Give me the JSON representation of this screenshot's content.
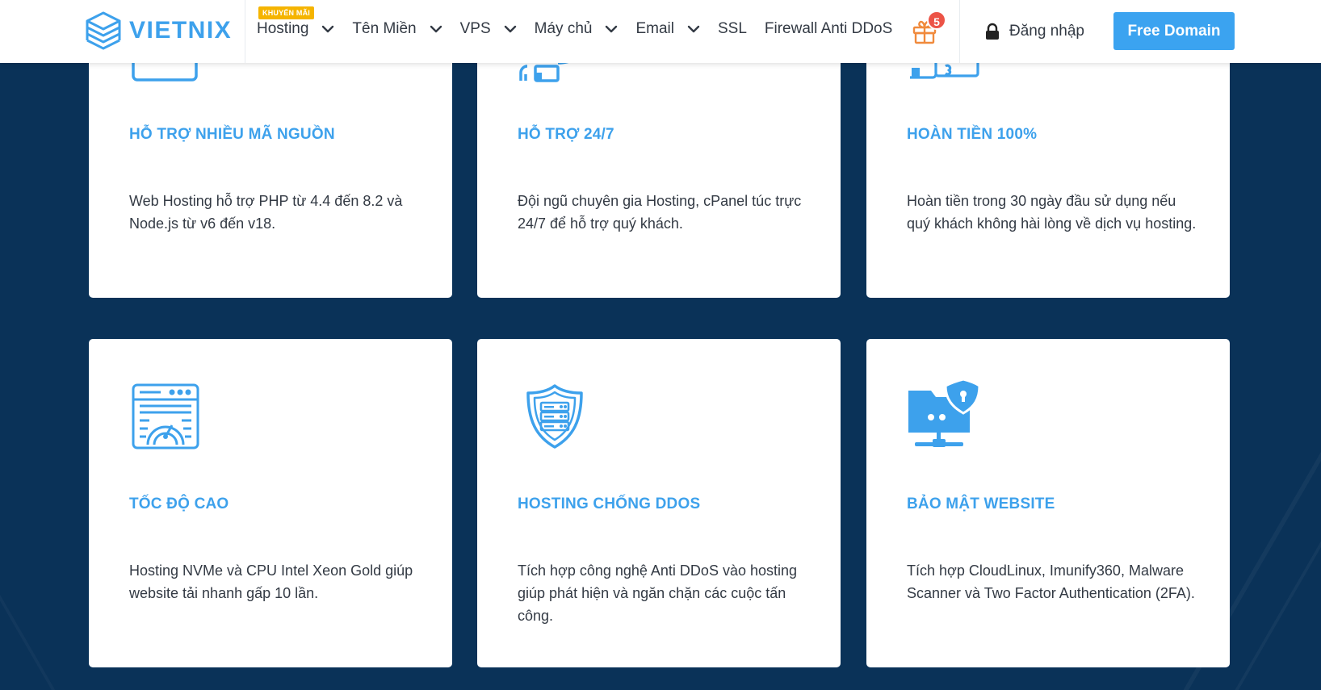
{
  "brand": {
    "name": "VIETNIX",
    "color": "#3da1ec"
  },
  "nav": {
    "promo_badge": "KHUYẾN MÃI",
    "items": [
      {
        "label": "Hosting",
        "dropdown": true
      },
      {
        "label": "Tên Miền",
        "dropdown": true
      },
      {
        "label": "VPS",
        "dropdown": true
      },
      {
        "label": "Máy chủ",
        "dropdown": true
      },
      {
        "label": "Email",
        "dropdown": true
      },
      {
        "label": "SSL",
        "dropdown": false
      },
      {
        "label": "Firewall Anti DDoS",
        "dropdown": false
      }
    ],
    "gift_count": "5",
    "login_label": "Đăng nhập",
    "cta_label": "Free Domain"
  },
  "colors": {
    "background": "#0a3258",
    "accent": "#3ba3f0",
    "badge": "#ec5346",
    "promo": "#f5b400"
  },
  "features": [
    {
      "icon": "code-window-icon",
      "title": "HỖ TRỢ NHIỀU MÃ NGUỒN",
      "text": "Web Hosting hỗ trợ PHP từ 4.4 đến 8.2 và Node.js từ v6 đến v18."
    },
    {
      "icon": "support-agent-icon",
      "title": "HỖ TRỢ 24/7",
      "text": "Đội ngũ chuyên gia Hosting, cPanel túc trực 24/7 để hỗ trợ quý khách."
    },
    {
      "icon": "money-refund-icon",
      "title": "HOÀN TIỀN 100%",
      "text": "Hoàn tiền trong 30 ngày đầu sử dụng nếu quý khách không hài lòng về dịch vụ hosting."
    },
    {
      "icon": "speed-gauge-icon",
      "title": "TỐC ĐỘ CAO",
      "text": "Hosting NVMe và CPU Intel Xeon Gold giúp website tải nhanh gấp 10 lần."
    },
    {
      "icon": "shield-server-icon",
      "title": "HOSTING CHỐNG DDOS",
      "text": "Tích hợp công nghệ Anti DDoS vào hosting giúp phát hiện và ngăn chặn các cuộc tấn công."
    },
    {
      "icon": "secure-folder-icon",
      "title": "BẢO MẬT WEBSITE",
      "text": "Tích hợp CloudLinux, Imunify360, Malware Scanner và Two Factor Authentication (2FA)."
    }
  ]
}
